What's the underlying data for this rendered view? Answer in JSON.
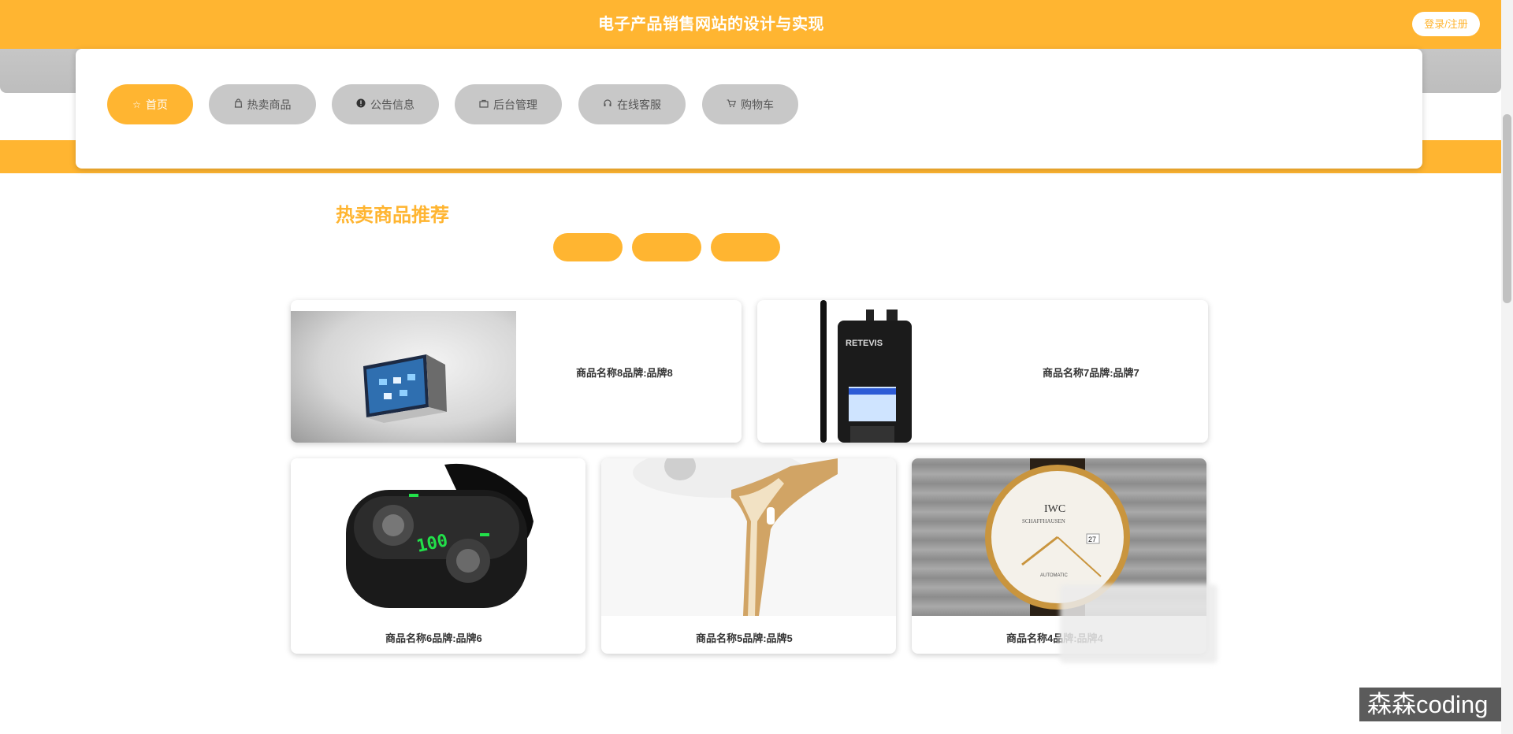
{
  "header": {
    "site_title": "电子产品销售网站的设计与实现",
    "login_label": "登录/注册"
  },
  "nav": {
    "items": [
      {
        "label": "首页",
        "icon": "star-icon",
        "active": true
      },
      {
        "label": "热卖商品",
        "icon": "bag-icon",
        "active": false
      },
      {
        "label": "公告信息",
        "icon": "info-icon",
        "active": false
      },
      {
        "label": "后台管理",
        "icon": "briefcase-icon",
        "active": false
      },
      {
        "label": "在线客服",
        "icon": "headset-icon",
        "active": false
      },
      {
        "label": "购物车",
        "icon": "cart-icon",
        "active": false
      }
    ]
  },
  "section": {
    "title": "热卖商品推荐"
  },
  "products": [
    {
      "label": "商品名称8品牌:品牌8",
      "image": "tablet-dock-photo"
    },
    {
      "label": "商品名称7品牌:品牌7",
      "image": "walkie-talkie-photo"
    },
    {
      "label": "商品名称6品牌:品牌6",
      "image": "earbuds-case-photo"
    },
    {
      "label": "商品名称5品牌:品牌5",
      "image": "hair-dryer-photo"
    },
    {
      "label": "商品名称4品牌:品牌4",
      "image": "gold-watch-photo"
    }
  ],
  "watermark": "森森coding",
  "colors": {
    "accent": "#ffb531",
    "nav_inactive": "#c8c8c8"
  }
}
